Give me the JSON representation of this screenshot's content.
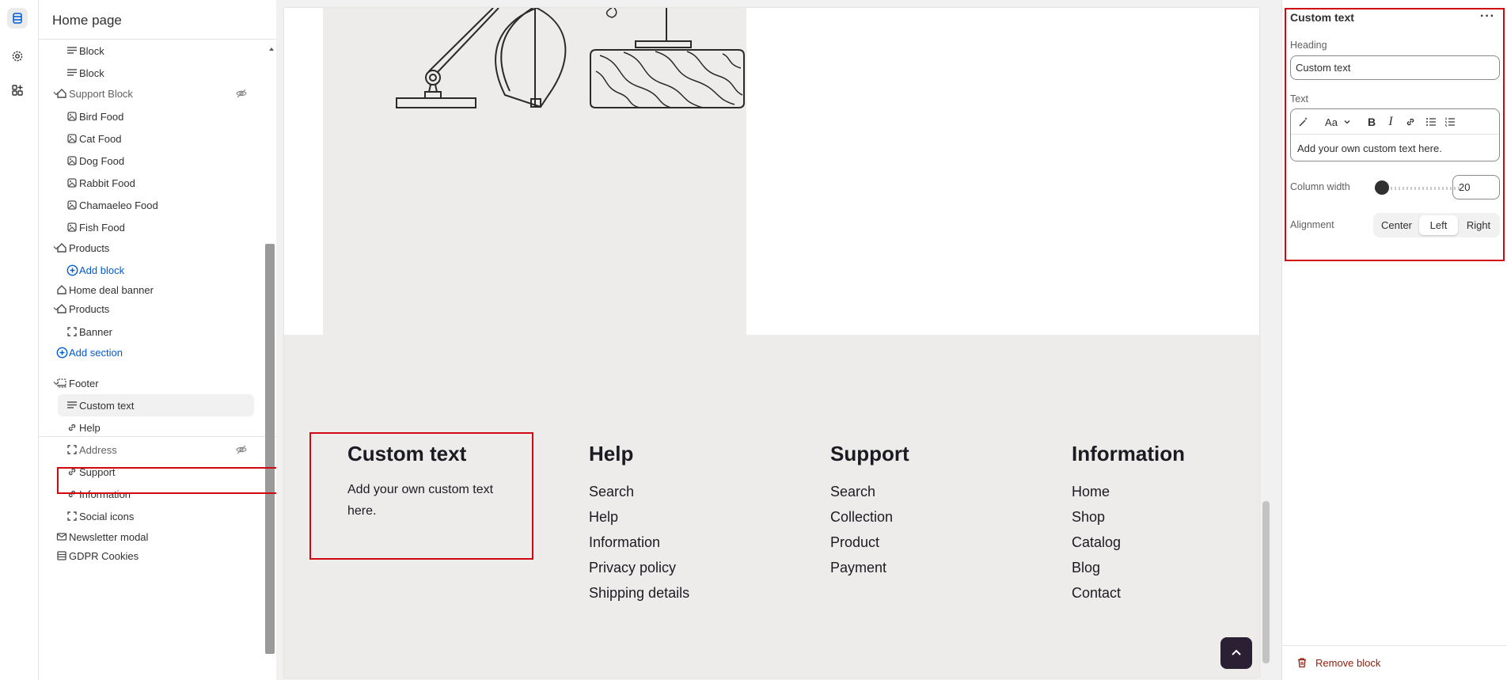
{
  "left_panel": {
    "title": "Home page",
    "tree": [
      {
        "label": "Block",
        "type": "text-block",
        "depth": 2
      },
      {
        "label": "Block",
        "type": "text-block",
        "depth": 2
      },
      {
        "label": "Support Block",
        "type": "section",
        "depth": 1,
        "hidden": true
      },
      {
        "label": "Bird Food",
        "type": "image-block",
        "depth": 2
      },
      {
        "label": "Cat Food",
        "type": "image-block",
        "depth": 2
      },
      {
        "label": "Dog Food",
        "type": "image-block",
        "depth": 2
      },
      {
        "label": "Rabbit Food",
        "type": "image-block",
        "depth": 2
      },
      {
        "label": "Chamaeleo Food",
        "type": "image-block",
        "depth": 2
      },
      {
        "label": "Fish Food",
        "type": "image-block",
        "depth": 2
      },
      {
        "label": "Products",
        "type": "section",
        "depth": 1
      },
      {
        "label": "Add block",
        "type": "add",
        "depth": 2
      },
      {
        "label": "Home deal banner",
        "type": "section-flat",
        "depth": 1
      },
      {
        "label": "Products",
        "type": "section",
        "depth": 1
      },
      {
        "label": "Banner",
        "type": "frame-block",
        "depth": 2
      },
      {
        "label": "Add section",
        "type": "add",
        "depth": 1
      },
      {
        "label": "Footer",
        "type": "footer",
        "depth": 1
      },
      {
        "label": "Custom text",
        "type": "text-block",
        "depth": 2,
        "selected": true
      },
      {
        "label": "Help",
        "type": "link-block",
        "depth": 2
      },
      {
        "label": "Address",
        "type": "frame-block",
        "depth": 2,
        "hidden": true
      },
      {
        "label": "Support",
        "type": "link-block",
        "depth": 2
      },
      {
        "label": "Information",
        "type": "link-block",
        "depth": 2
      },
      {
        "label": "Social icons",
        "type": "frame-block",
        "depth": 2
      },
      {
        "label": "Newsletter modal",
        "type": "mail",
        "depth": 1
      },
      {
        "label": "GDPR Cookies",
        "type": "cookie",
        "depth": 1
      }
    ]
  },
  "preview": {
    "footer": {
      "custom_text": {
        "heading": "Custom text",
        "body": "Add your own custom text here."
      },
      "help": {
        "heading": "Help",
        "links": [
          "Search",
          "Help",
          "Information",
          "Privacy policy",
          "Shipping details"
        ]
      },
      "support": {
        "heading": "Support",
        "links": [
          "Search",
          "Collection",
          "Product",
          "Payment"
        ]
      },
      "information": {
        "heading": "Information",
        "links": [
          "Home",
          "Shop",
          "Catalog",
          "Blog",
          "Contact"
        ]
      }
    }
  },
  "settings": {
    "title": "Custom text",
    "heading_label": "Heading",
    "heading_value": "Custom text",
    "text_label": "Text",
    "text_value": "Add your own custom text here.",
    "column_width_label": "Column width",
    "column_width_value": "20",
    "column_width_fraction": 0.05,
    "alignment_label": "Alignment",
    "alignment_options": [
      "Center",
      "Left",
      "Right"
    ],
    "alignment_selected": "Left",
    "remove_label": "Remove block"
  },
  "colors": {
    "accent_link": "#005bd3",
    "highlight_red": "#d1080f",
    "danger": "#8e1f0b",
    "footer_bg": "#edeceb"
  }
}
